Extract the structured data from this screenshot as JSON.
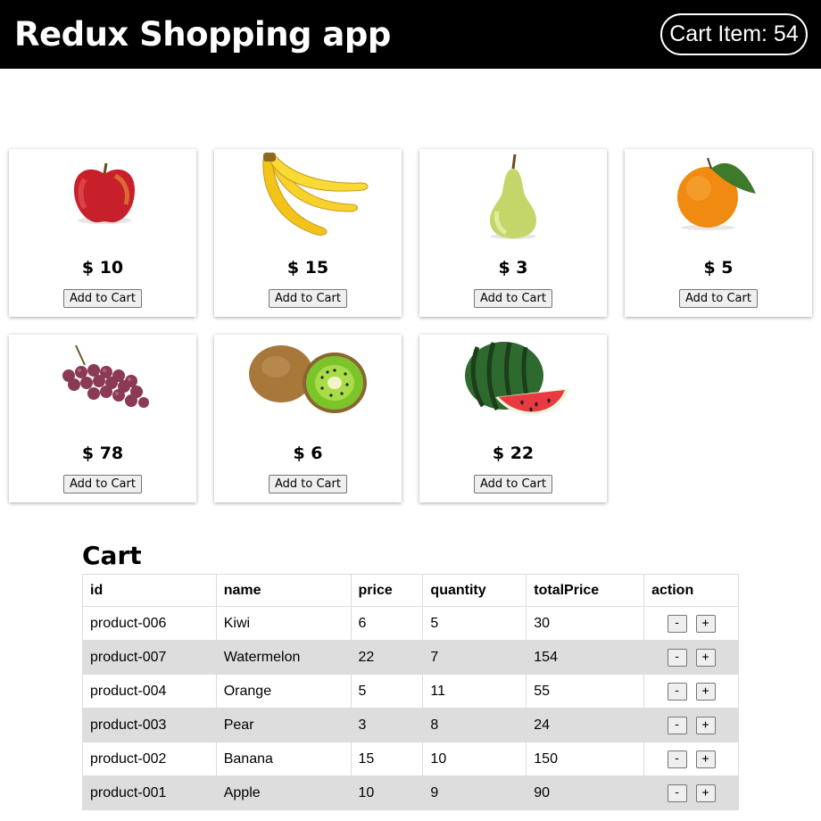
{
  "header": {
    "title": "Redux Shopping app",
    "cart_badge": "Cart Item: 54"
  },
  "products": [
    {
      "image": "apple-image",
      "price": "$ 10",
      "button": "Add to Cart"
    },
    {
      "image": "banana-image",
      "price": "$ 15",
      "button": "Add to Cart"
    },
    {
      "image": "pear-image",
      "price": "$ 3",
      "button": "Add to Cart"
    },
    {
      "image": "orange-image",
      "price": "$ 5",
      "button": "Add to Cart"
    },
    {
      "image": "grapes-image",
      "price": "$ 78",
      "button": "Add to Cart"
    },
    {
      "image": "kiwi-image",
      "price": "$ 6",
      "button": "Add to Cart"
    },
    {
      "image": "watermelon-image",
      "price": "$ 22",
      "button": "Add to Cart"
    }
  ],
  "cart": {
    "heading": "Cart",
    "columns": [
      "id",
      "name",
      "price",
      "quantity",
      "totalPrice",
      "action"
    ],
    "decrement_label": "-",
    "increment_label": "+",
    "rows": [
      {
        "id": "product-006",
        "name": "Kiwi",
        "price": "6",
        "quantity": "5",
        "totalPrice": "30"
      },
      {
        "id": "product-007",
        "name": "Watermelon",
        "price": "22",
        "quantity": "7",
        "totalPrice": "154"
      },
      {
        "id": "product-004",
        "name": "Orange",
        "price": "5",
        "quantity": "11",
        "totalPrice": "55"
      },
      {
        "id": "product-003",
        "name": "Pear",
        "price": "3",
        "quantity": "8",
        "totalPrice": "24"
      },
      {
        "id": "product-002",
        "name": "Banana",
        "price": "15",
        "quantity": "10",
        "totalPrice": "150"
      },
      {
        "id": "product-001",
        "name": "Apple",
        "price": "10",
        "quantity": "9",
        "totalPrice": "90"
      }
    ]
  },
  "colors": {
    "header_bg": "#000000",
    "row_stripe": "#dddddd"
  }
}
